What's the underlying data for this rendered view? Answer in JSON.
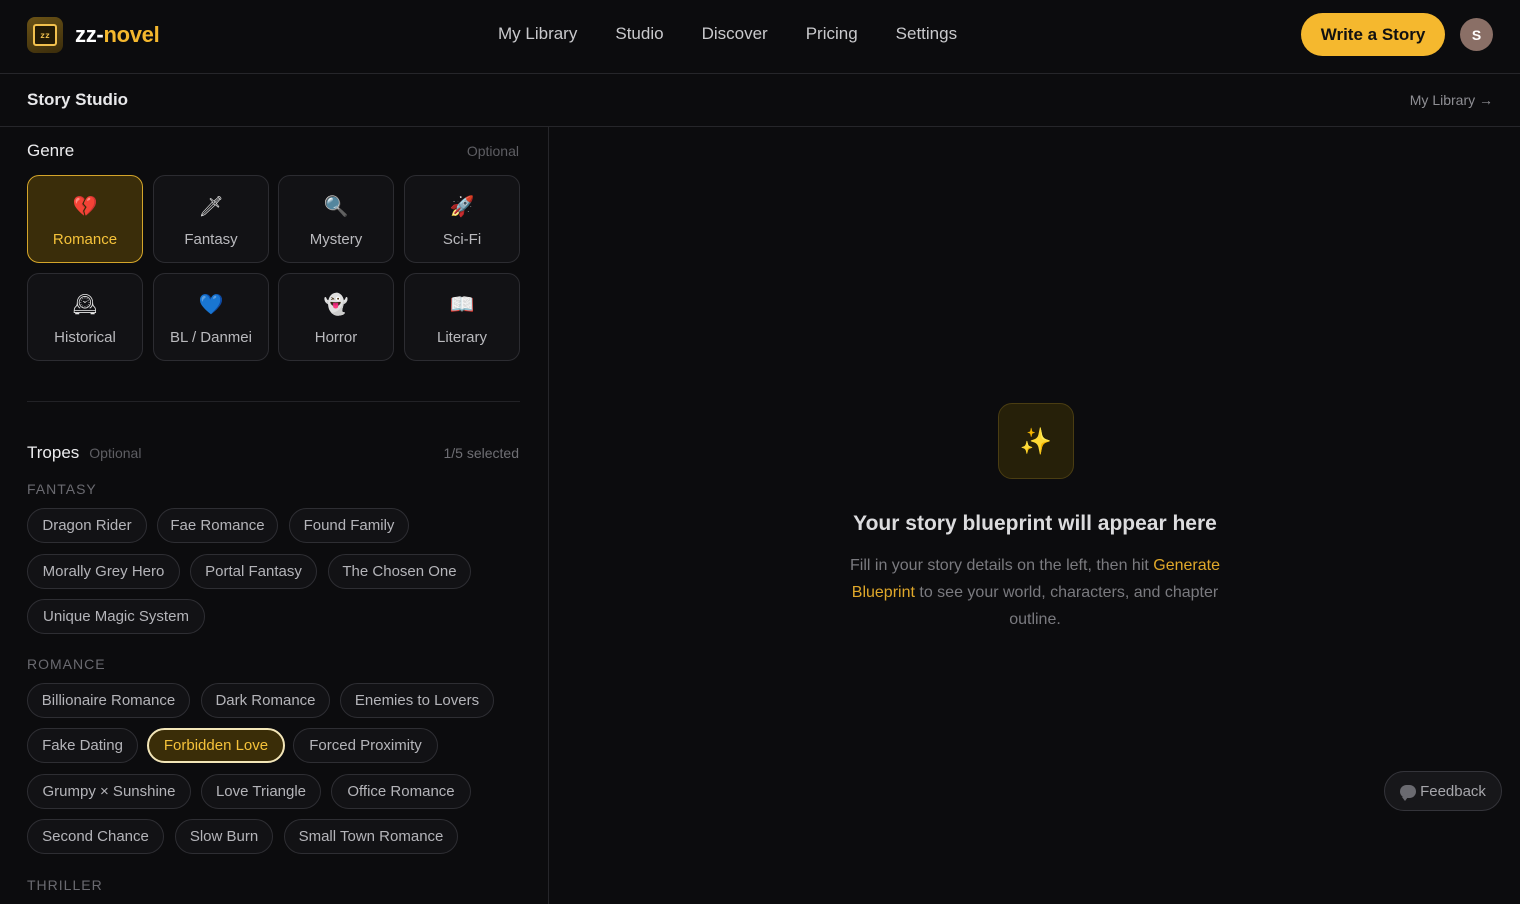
{
  "brand": {
    "name_part1": "zz-",
    "name_part2": "novel",
    "logo_text": "zz"
  },
  "nav": {
    "links": [
      "My Library",
      "Studio",
      "Discover",
      "Pricing",
      "Settings"
    ]
  },
  "header": {
    "cta_label": "Write a Story",
    "avatar_initial": "S"
  },
  "subheader": {
    "title": "Story Studio",
    "library_link": "My Library →"
  },
  "genre": {
    "title": "Genre",
    "optional": "Optional",
    "items": [
      {
        "label": "Romance",
        "icon": "broken-heart-icon",
        "glyph": "💔",
        "selected": true
      },
      {
        "label": "Fantasy",
        "icon": "dagger-icon",
        "glyph": "🗡",
        "selected": false
      },
      {
        "label": "Mystery",
        "icon": "magnifier-icon",
        "glyph": "🔍",
        "selected": false
      },
      {
        "label": "Sci-Fi",
        "icon": "rocket-icon",
        "glyph": "🚀",
        "selected": false
      },
      {
        "label": "Historical",
        "icon": "clock-icon",
        "glyph": "🕰",
        "selected": false
      },
      {
        "label": "BL / Danmei",
        "icon": "blue-heart-icon",
        "glyph": "💙",
        "selected": false
      },
      {
        "label": "Horror",
        "icon": "ghost-icon",
        "glyph": "👻",
        "selected": false
      },
      {
        "label": "Literary",
        "icon": "open-book-icon",
        "glyph": "📖",
        "selected": false
      }
    ]
  },
  "tropes": {
    "title": "Tropes",
    "optional": "Optional",
    "selected_count": "1/5 selected",
    "categories": [
      {
        "name": "FANTASY",
        "items": [
          "Dragon Rider",
          "Fae Romance",
          "Found Family",
          "Morally Grey Hero",
          "Portal Fantasy",
          "The Chosen One",
          "Unique Magic System"
        ]
      },
      {
        "name": "ROMANCE",
        "items": [
          "Billionaire Romance",
          "Dark Romance",
          "Enemies to Lovers",
          "Fake Dating",
          "Forbidden Love",
          "Forced Proximity",
          "Grumpy × Sunshine",
          "Love Triangle",
          "Office Romance",
          "Second Chance",
          "Slow Burn",
          "Small Town Romance"
        ]
      },
      {
        "name": "THRILLER",
        "items": []
      }
    ],
    "selected": [
      "Forbidden Love"
    ]
  },
  "blueprint": {
    "icon": "sparkles-icon",
    "glyph": "✨",
    "title": "Your story blueprint will appear here",
    "desc_before": "Fill in your story details on the left, then hit",
    "desc_link": "Generate Blueprint",
    "desc_after": "to see your world, characters, and chapter outline."
  },
  "feedback_label": "Feedback",
  "colors": {
    "accent": "#f5b82e",
    "background": "#0c0c0e",
    "selected_fill": "#3a2d0a"
  }
}
